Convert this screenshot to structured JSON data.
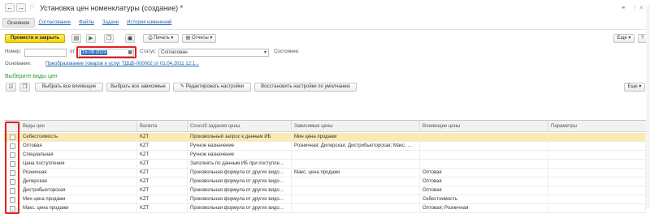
{
  "window": {
    "title": "Установка цен номенклатуры (создание) *",
    "back_glyph": "←",
    "forward_glyph": "→",
    "star_glyph": "☆",
    "link_glyph": "⚭",
    "menu_glyph": "⋮",
    "close_glyph": "×"
  },
  "tabs": [
    "Основное",
    "Согласование",
    "Файлы",
    "Задачи",
    "История изменений"
  ],
  "toolbar": {
    "post_close": "Провести и закрыть",
    "print": "Печать",
    "reports": "Отчеты",
    "more": "Еще",
    "help": "?"
  },
  "form": {
    "number_label": "Номер:",
    "number_value": "",
    "date_label": "от:",
    "date_value": "15.09.2023",
    "status_label": "Статус:",
    "status_value": "Согласован",
    "state_label": "Состояние:",
    "basis_label": "Основание:",
    "basis_value": "Преобразование товаров и услуг ТДЦБ-000002 от 01.04.2011 12:1..."
  },
  "section": {
    "title": "Выберите виды цен",
    "btn_select_affecting": "Выбрать все влияющие",
    "btn_select_dependent": "Выбрать все зависимые",
    "btn_edit_settings": "Редактировать настройки",
    "btn_restore_defaults": "Восстановить настройки по умолчанию",
    "more": "Еще"
  },
  "table": {
    "columns": [
      "Виды цен",
      "Валюта",
      "Способ задания цены",
      "Зависимые цены",
      "Влияющие цены",
      "Параметры"
    ],
    "rows": [
      {
        "name": "Себестоимость",
        "currency": "KZT",
        "method": "Произвольный запрос к данным ИБ",
        "dependent": "Мин цена продажи",
        "affecting": "",
        "params": ""
      },
      {
        "name": "Оптовая",
        "currency": "KZT",
        "method": "Ручное назначение",
        "dependent": "Розничная; Дилерская; Дистрибьюторская; Макс. ...",
        "affecting": "",
        "params": ""
      },
      {
        "name": "Специальная",
        "currency": "KZT",
        "method": "Ручное назначение",
        "dependent": "",
        "affecting": "",
        "params": ""
      },
      {
        "name": "Цена поступления",
        "currency": "KZT",
        "method": "Заполнять по данным ИБ при поступле...",
        "dependent": "",
        "affecting": "",
        "params": ""
      },
      {
        "name": "Розничная",
        "currency": "KZT",
        "method": "Произвольная формула от других видо...",
        "dependent": "Макс. цена продажи",
        "affecting": "Оптовая",
        "params": ""
      },
      {
        "name": "Дилерская",
        "currency": "KZT",
        "method": "Произвольная формула от других видо...",
        "dependent": "",
        "affecting": "Оптовая",
        "params": ""
      },
      {
        "name": "Дистрибьюторская",
        "currency": "KZT",
        "method": "Произвольная формула от других видо...",
        "dependent": "",
        "affecting": "Оптовая",
        "params": ""
      },
      {
        "name": "Мин цена продажи",
        "currency": "KZT",
        "method": "Произвольная формула от других видо...",
        "dependent": "",
        "affecting": "Себестоимость",
        "params": ""
      },
      {
        "name": "Макс. цена продажи",
        "currency": "KZT",
        "method": "Произвольная формула от других видо...",
        "dependent": "",
        "affecting": "Оптовая; Розничная",
        "params": ""
      }
    ]
  },
  "colors": {
    "accent_yellow": "#f5d300",
    "selected_row": "#fbeab0",
    "section_green": "#2aa02a",
    "link_blue": "#1a5fb4",
    "highlight_red": "#e02020"
  }
}
